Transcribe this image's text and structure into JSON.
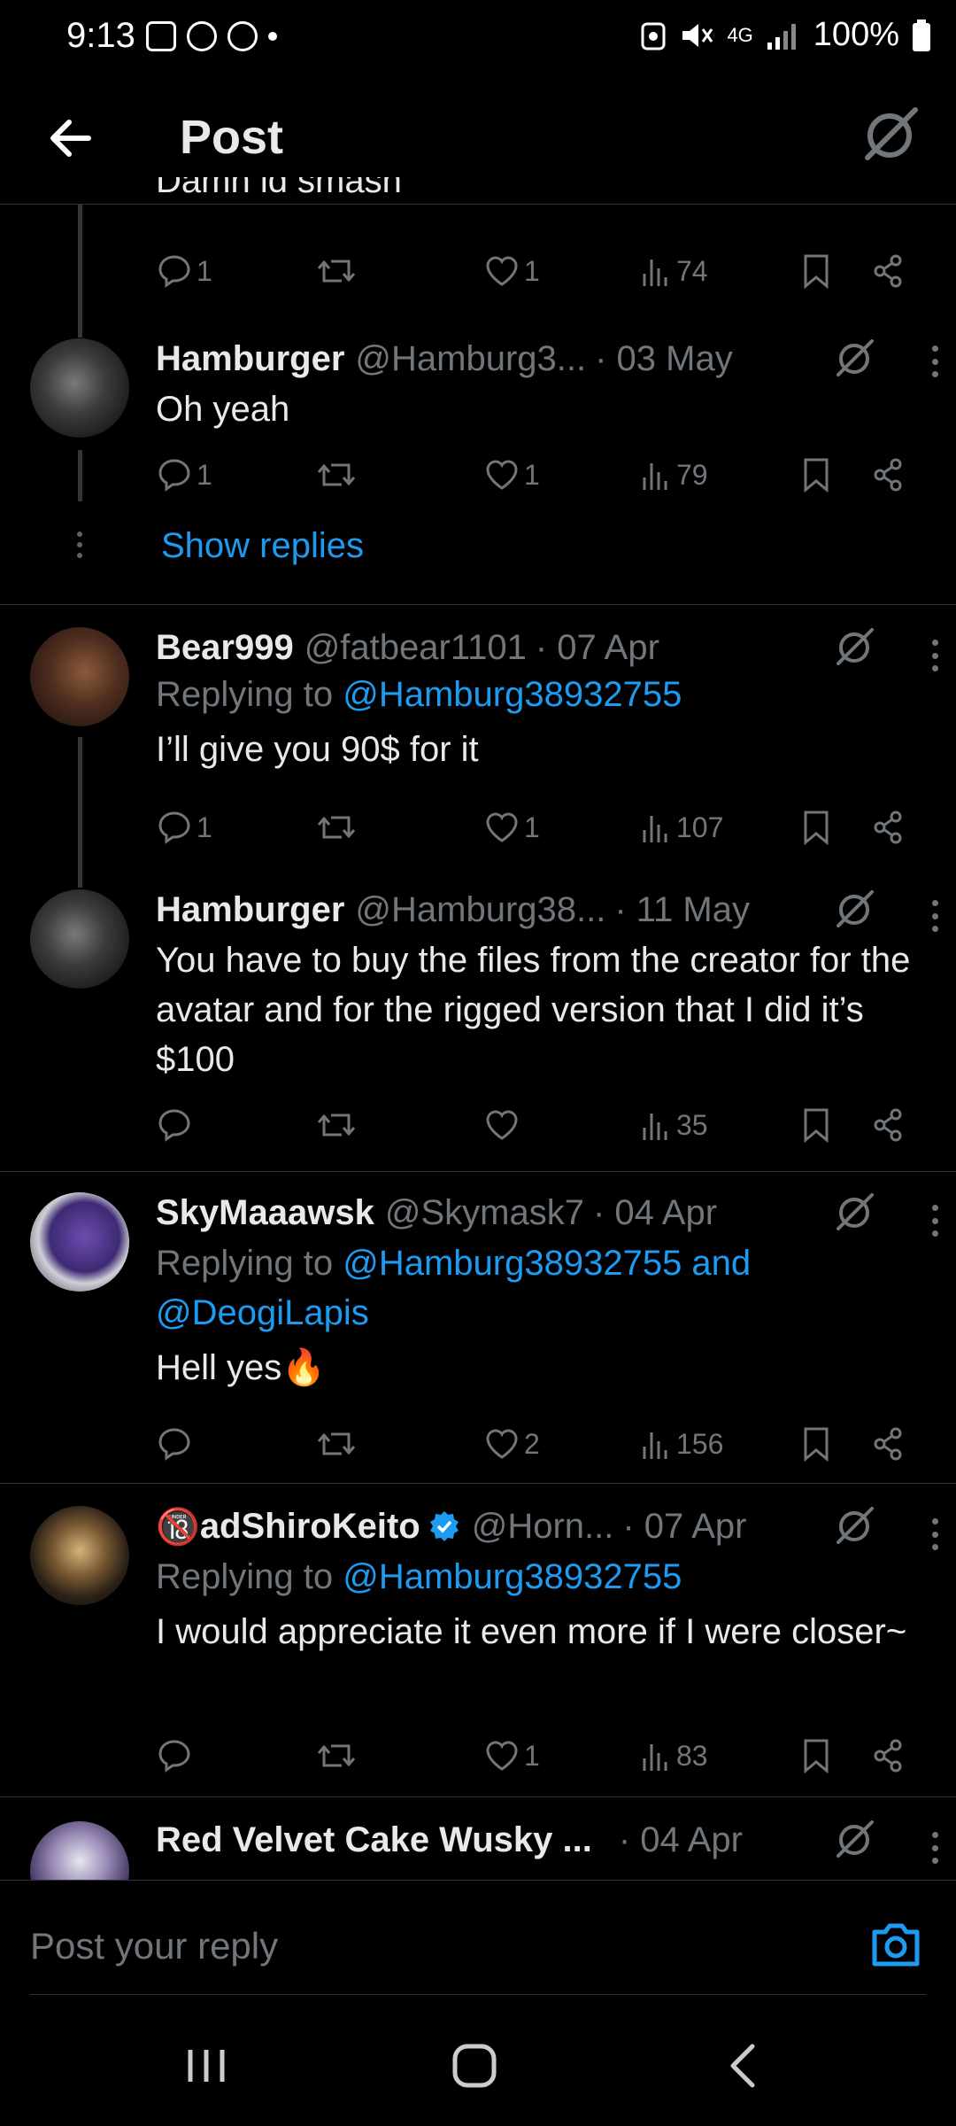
{
  "status_bar": {
    "time": "9:13",
    "network": "4G",
    "battery": "100%"
  },
  "header": {
    "title": "Post"
  },
  "colors": {
    "background": "#000000",
    "text": "#e7e9ea",
    "secondary": "#71767b",
    "accent": "#1d9bf0",
    "divider": "#2f3336"
  },
  "tweets": [
    {
      "body": "Damn id smash",
      "metrics": {
        "replies": "1",
        "retweets": "",
        "likes": "1",
        "views": "74"
      }
    },
    {
      "name": "Hamburger",
      "handle": "@Hamburg3...",
      "date": "· 03 May",
      "body": "Oh yeah",
      "metrics": {
        "replies": "1",
        "retweets": "",
        "likes": "1",
        "views": "79"
      },
      "show_replies": "Show replies"
    },
    {
      "name": "Bear999",
      "handle": "@fatbear1101",
      "date": "· 07 Apr",
      "replying_prefix": "Replying to ",
      "replying_to": "@Hamburg38932755",
      "body": "I’ll give you 90$ for it",
      "metrics": {
        "replies": "1",
        "retweets": "",
        "likes": "1",
        "views": "107"
      }
    },
    {
      "name": "Hamburger",
      "handle": "@Hamburg38...",
      "date": "· 11 May",
      "body": "You have to buy the files from the creator for the avatar and for the rigged version that I did it’s $100",
      "metrics": {
        "replies": "",
        "retweets": "",
        "likes": "",
        "views": "35"
      }
    },
    {
      "name": "SkyMaaawsk",
      "handle": "@Skymask7",
      "date": "· 04 Apr",
      "replying_prefix": "Replying to ",
      "replying_to": "@Hamburg38932755 and",
      "replying_to_2": "@DeogiLapis",
      "body": "Hell yes🔥",
      "metrics": {
        "replies": "",
        "retweets": "",
        "likes": "2",
        "views": "156"
      }
    },
    {
      "name_prefix_emoji": "🔞",
      "name": "adShiroKeito",
      "verified": true,
      "handle": "@Horn...",
      "date": "· 07 Apr",
      "replying_prefix": "Replying to ",
      "replying_to": "@Hamburg38932755",
      "body": "I would appreciate it even more if I were closer~",
      "metrics": {
        "replies": "",
        "retweets": "",
        "likes": "1",
        "views": "83"
      }
    },
    {
      "name": "Red Velvet Cake Wusky ...",
      "date": "· 04 Apr"
    }
  ],
  "composer": {
    "placeholder": "Post your reply"
  }
}
